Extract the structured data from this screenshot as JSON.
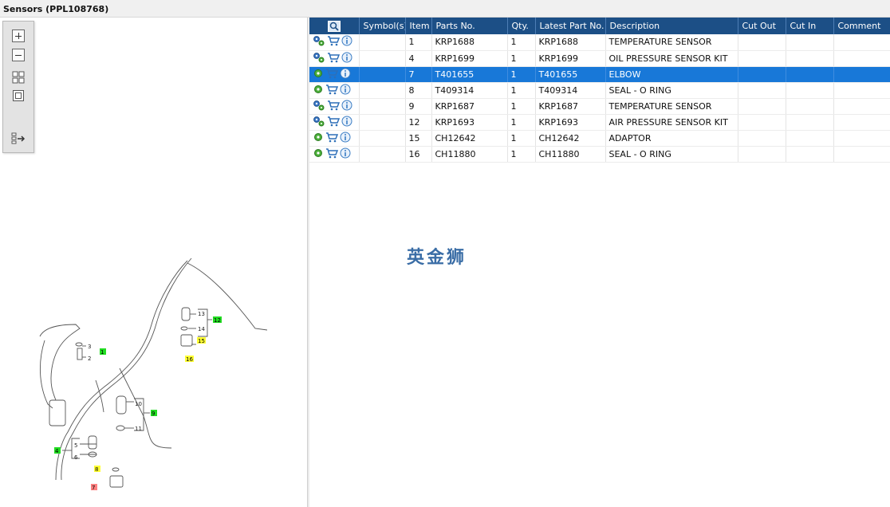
{
  "window": {
    "title": "Sensors (PPL108768)"
  },
  "toolbar": {
    "buttons": [
      {
        "name": "zoom-in-button",
        "icon": "zoom-in-icon"
      },
      {
        "name": "zoom-out-button",
        "icon": "zoom-out-icon"
      },
      {
        "name": "fit-all-button",
        "icon": "fit-all-icon"
      },
      {
        "name": "actual-size-button",
        "icon": "actual-size-icon"
      },
      {
        "name": "export-list-button",
        "icon": "list-export-icon"
      }
    ]
  },
  "table": {
    "columns": [
      "",
      "Symbol(s)",
      "Item",
      "Parts No.",
      "Qty.",
      "Latest Part No.",
      "Description",
      "Cut Out",
      "Cut In",
      "Comment"
    ],
    "selected_index": 2,
    "rows": [
      {
        "gear_icon": "gears-icon",
        "symbol": "",
        "item": "1",
        "part_no": "KRP1688",
        "qty": "1",
        "latest_part_no": "KRP1688",
        "description": "TEMPERATURE SENSOR",
        "cut_out": "",
        "cut_in": "",
        "comment": ""
      },
      {
        "gear_icon": "gears-icon",
        "symbol": "",
        "item": "4",
        "part_no": "KRP1699",
        "qty": "1",
        "latest_part_no": "KRP1699",
        "description": "OIL PRESSURE SENSOR KIT",
        "cut_out": "",
        "cut_in": "",
        "comment": ""
      },
      {
        "gear_icon": "gear-icon",
        "symbol": "",
        "item": "7",
        "part_no": "T401655",
        "qty": "1",
        "latest_part_no": "T401655",
        "description": "ELBOW",
        "cut_out": "",
        "cut_in": "",
        "comment": ""
      },
      {
        "gear_icon": "gear-icon",
        "symbol": "",
        "item": "8",
        "part_no": "T409314",
        "qty": "1",
        "latest_part_no": "T409314",
        "description": "SEAL - O RING",
        "cut_out": "",
        "cut_in": "",
        "comment": ""
      },
      {
        "gear_icon": "gears-icon",
        "symbol": "",
        "item": "9",
        "part_no": "KRP1687",
        "qty": "1",
        "latest_part_no": "KRP1687",
        "description": "TEMPERATURE SENSOR",
        "cut_out": "",
        "cut_in": "",
        "comment": ""
      },
      {
        "gear_icon": "gears-icon",
        "symbol": "",
        "item": "12",
        "part_no": "KRP1693",
        "qty": "1",
        "latest_part_no": "KRP1693",
        "description": "AIR PRESSURE SENSOR KIT",
        "cut_out": "",
        "cut_in": "",
        "comment": ""
      },
      {
        "gear_icon": "gear-icon",
        "symbol": "",
        "item": "15",
        "part_no": "CH12642",
        "qty": "1",
        "latest_part_no": "CH12642",
        "description": "ADAPTOR",
        "cut_out": "",
        "cut_in": "",
        "comment": ""
      },
      {
        "gear_icon": "gear-icon",
        "symbol": "",
        "item": "16",
        "part_no": "CH11880",
        "qty": "1",
        "latest_part_no": "CH11880",
        "description": "SEAL - O RING",
        "cut_out": "",
        "cut_in": "",
        "comment": ""
      }
    ]
  },
  "diagram": {
    "labels": [
      "13",
      "14",
      "12",
      "15",
      "16",
      "3",
      "2",
      "1",
      "10",
      "9",
      "11",
      "5",
      "4",
      "6",
      "8",
      "7"
    ]
  },
  "watermark": {
    "text": "英金狮"
  },
  "colors": {
    "header": "#1c4f86",
    "selected_row": "#1878d8",
    "callout_green": "#22dd22",
    "callout_yellow": "#ffff33",
    "callout_red": "#ff8080"
  }
}
